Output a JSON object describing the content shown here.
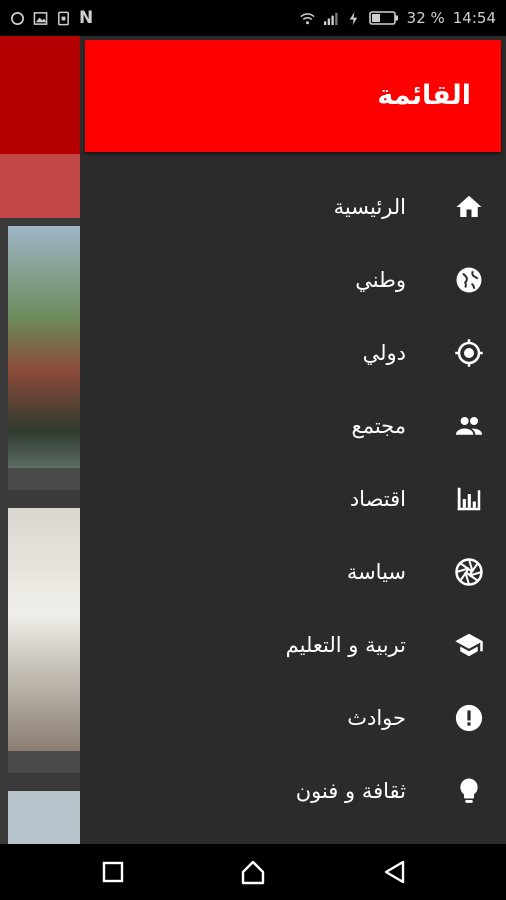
{
  "status_bar": {
    "battery": "32 %",
    "time": "14:54",
    "carrier_letter": "N"
  },
  "drawer": {
    "title": "القائمة",
    "items": [
      {
        "label": "الرئيسية",
        "icon": "home-icon"
      },
      {
        "label": "وطني",
        "icon": "globe-icon"
      },
      {
        "label": "دولي",
        "icon": "location-target-icon"
      },
      {
        "label": "مجتمع",
        "icon": "people-icon"
      },
      {
        "label": "اقتصاد",
        "icon": "bar-chart-icon"
      },
      {
        "label": "سياسة",
        "icon": "aperture-icon"
      },
      {
        "label": "تربية و التعليم",
        "icon": "graduation-cap-icon"
      },
      {
        "label": "حوادث",
        "icon": "alert-icon"
      },
      {
        "label": "ثقافة و فنون",
        "icon": "lightbulb-icon"
      }
    ]
  },
  "colors": {
    "header_red": "#ff0000",
    "drawer_bg": "#2b2b2b",
    "text": "#ffffff"
  }
}
